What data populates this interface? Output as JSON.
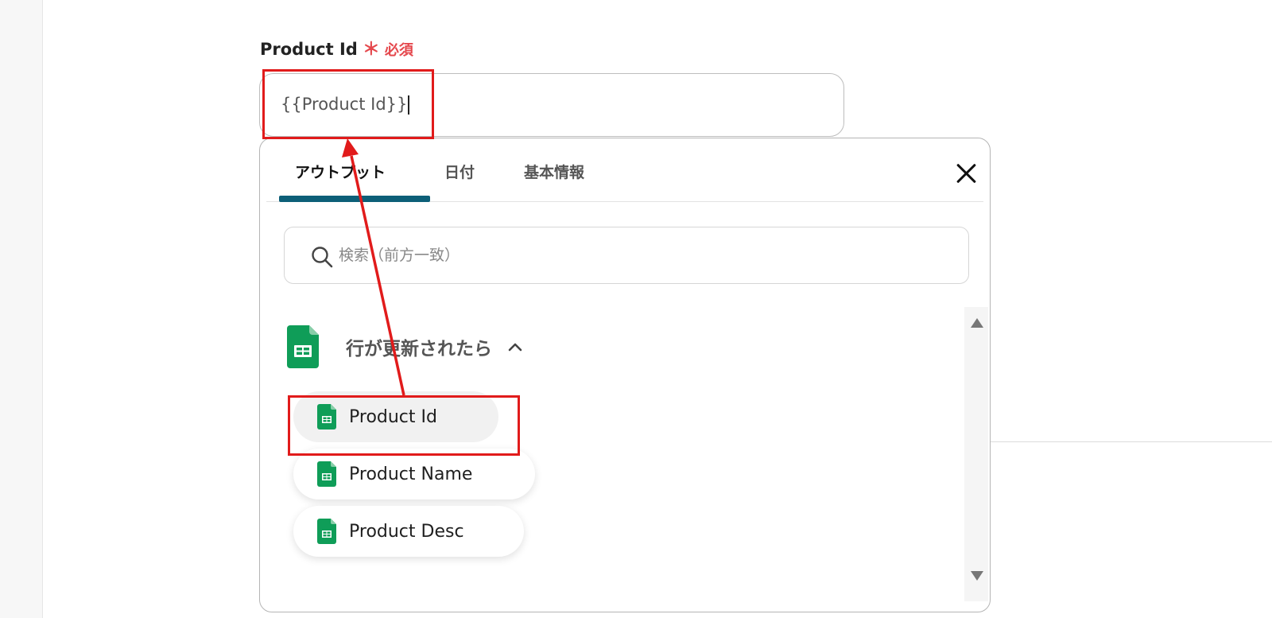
{
  "field": {
    "label": "Product Id",
    "required_mark": "＊",
    "required_text": "必須",
    "value": "{{Product Id}}"
  },
  "popup": {
    "tabs": [
      {
        "label": "アウトプット",
        "active": true
      },
      {
        "label": "日付",
        "active": false
      },
      {
        "label": "基本情報",
        "active": false
      }
    ],
    "search": {
      "placeholder": "検索（前方一致）"
    },
    "group": {
      "title": "行が更新されたら",
      "icon": "google-sheets-icon",
      "expanded": true
    },
    "items": [
      {
        "label": "Product Id",
        "icon": "google-sheets-icon",
        "selected": true
      },
      {
        "label": "Product Name",
        "icon": "google-sheets-icon",
        "selected": false
      },
      {
        "label": "Product Desc",
        "icon": "google-sheets-icon",
        "selected": false
      }
    ]
  },
  "colors": {
    "accent_tab": "#0d5f78",
    "required": "#e5484d",
    "annotation_red": "#e11b1b",
    "sheets_green": "#0f9d58"
  }
}
